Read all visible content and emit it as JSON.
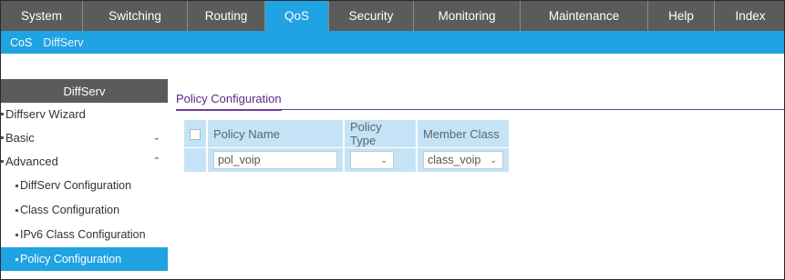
{
  "topnav": {
    "tabs": [
      {
        "label": "System"
      },
      {
        "label": "Switching"
      },
      {
        "label": "Routing"
      },
      {
        "label": "QoS"
      },
      {
        "label": "Security"
      },
      {
        "label": "Monitoring"
      },
      {
        "label": "Maintenance"
      },
      {
        "label": "Help"
      },
      {
        "label": "Index"
      }
    ],
    "active": "QoS"
  },
  "subnav": {
    "items": [
      {
        "label": "CoS"
      },
      {
        "label": "DiffServ"
      }
    ],
    "active": "DiffServ"
  },
  "sidebar": {
    "header": "DiffServ",
    "items": [
      {
        "label": "Diffserv Wizard"
      },
      {
        "label": "Basic",
        "icon": "chevron-down-icon"
      },
      {
        "label": "Advanced",
        "icon": "chevron-up-icon"
      },
      {
        "label": "DiffServ Configuration"
      },
      {
        "label": "Class Configuration"
      },
      {
        "label": "IPv6 Class Configuration"
      },
      {
        "label": "Policy Configuration"
      }
    ],
    "active": "Policy Configuration"
  },
  "main": {
    "tab_title": "Policy Configuration",
    "table": {
      "headers": [
        "Policy Name",
        "Policy Type",
        "Member Class"
      ],
      "row": {
        "policy_name": "pol_voip",
        "policy_type": "",
        "member_class": "class_voip"
      }
    }
  },
  "colors": {
    "nav_bg": "#5b5b5b",
    "accent": "#1fa3e3",
    "table_bg": "#c5e3f6",
    "tab_underline": "#6b3ea0"
  }
}
